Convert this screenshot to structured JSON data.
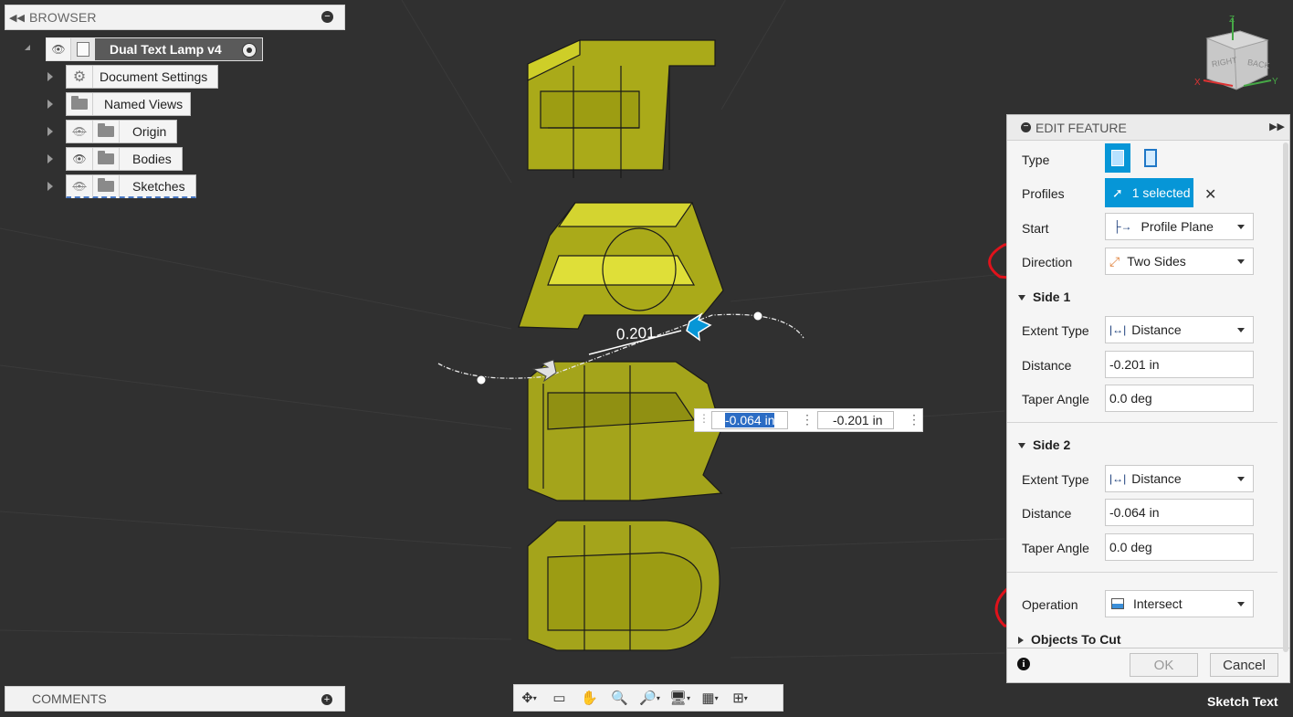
{
  "browser": {
    "title": "BROWSER",
    "root": "Dual Text Lamp v4",
    "items": [
      {
        "label": "Document Settings",
        "icon": "gear-icon"
      },
      {
        "label": "Named Views",
        "icon": "folder-icon"
      },
      {
        "label": "Origin",
        "icon": "folder-icon"
      },
      {
        "label": "Bodies",
        "icon": "folder-icon"
      },
      {
        "label": "Sketches",
        "icon": "folder-icon"
      }
    ]
  },
  "viewcube": {
    "right": "RIGHT",
    "back": "BACK",
    "x": "X",
    "y": "Y",
    "z": "Z"
  },
  "canvas": {
    "dimension_label": "0.201",
    "side2_input": "-0.064 in",
    "side1_input": "-0.201 in"
  },
  "edit_feature": {
    "title": "EDIT FEATURE",
    "type_label": "Type",
    "profiles_label": "Profiles",
    "profiles_value": "1 selected",
    "start_label": "Start",
    "start_value": "Profile Plane",
    "direction_label": "Direction",
    "direction_value": "Two Sides",
    "side1": {
      "title": "Side 1",
      "extent_label": "Extent Type",
      "extent_value": "Distance",
      "distance_label": "Distance",
      "distance_value": "-0.201 in",
      "taper_label": "Taper Angle",
      "taper_value": "0.0 deg"
    },
    "side2": {
      "title": "Side 2",
      "extent_label": "Extent Type",
      "extent_value": "Distance",
      "distance_label": "Distance",
      "distance_value": "-0.064 in",
      "taper_label": "Taper Angle",
      "taper_value": "0.0 deg"
    },
    "operation_label": "Operation",
    "operation_value": "Intersect",
    "objects_to_cut": "Objects To Cut",
    "ok": "OK",
    "cancel": "Cancel"
  },
  "comments": {
    "title": "COMMENTS"
  },
  "status_text": "Sketch Text",
  "colors": {
    "accent": "#0696d7",
    "annotation": "#e0121b",
    "body": "#b8b817",
    "background": "#303030"
  }
}
